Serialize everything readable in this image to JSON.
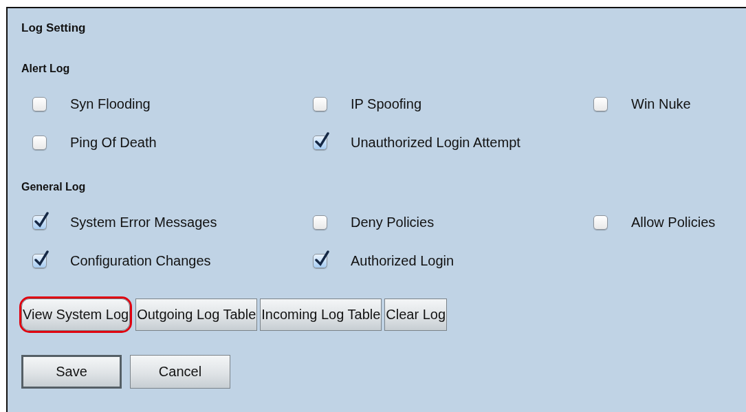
{
  "title": "Log Setting",
  "sections": [
    {
      "heading": "Alert Log",
      "options": [
        {
          "label": "Syn Flooding",
          "checked": false
        },
        {
          "label": "IP Spoofing",
          "checked": false
        },
        {
          "label": "Win Nuke",
          "checked": false
        },
        {
          "label": "Ping Of Death",
          "checked": false
        },
        {
          "label": "Unauthorized Login Attempt",
          "checked": true
        }
      ]
    },
    {
      "heading": "General Log",
      "options": [
        {
          "label": "System Error Messages",
          "checked": true
        },
        {
          "label": "Deny Policies",
          "checked": false
        },
        {
          "label": "Allow Policies",
          "checked": false
        },
        {
          "label": "Configuration Changes",
          "checked": true
        },
        {
          "label": "Authorized Login",
          "checked": true
        }
      ]
    }
  ],
  "log_buttons": [
    {
      "label": "View System Log",
      "highlighted": true
    },
    {
      "label": "Outgoing Log Table",
      "highlighted": false
    },
    {
      "label": "Incoming Log Table",
      "highlighted": false
    },
    {
      "label": "Clear Log",
      "highlighted": false
    }
  ],
  "form_buttons": [
    {
      "label": "Save",
      "primary": true
    },
    {
      "label": "Cancel",
      "primary": false
    }
  ]
}
